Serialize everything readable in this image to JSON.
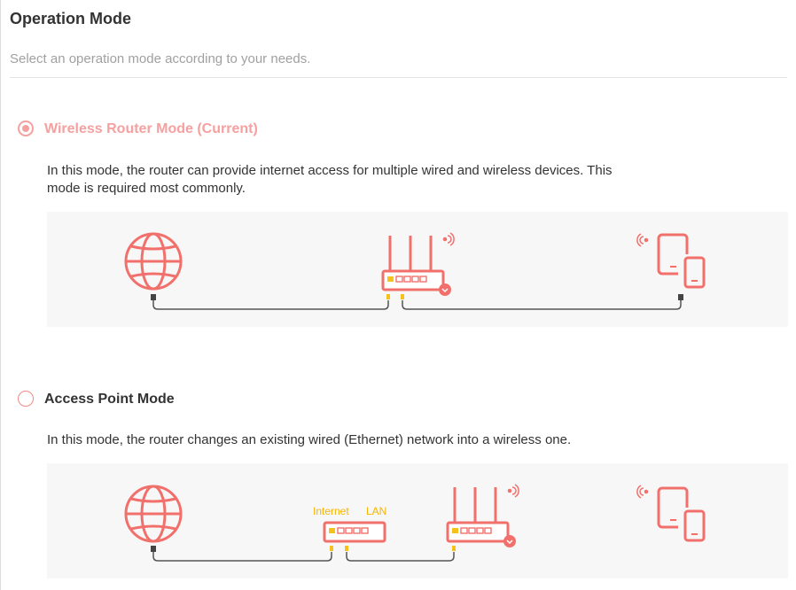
{
  "header": {
    "title": "Operation Mode",
    "subtitle": "Select an operation mode according to your needs."
  },
  "modes": [
    {
      "label": "Wireless Router Mode (Current)",
      "selected": true,
      "description_line1": "In this mode, the router can provide internet access for multiple wired and wireless devices. This",
      "description_line2": "mode is required most commonly."
    },
    {
      "label": "Access Point Mode",
      "selected": false,
      "description_line1": "In this mode, the router changes an existing wired (Ethernet) network into a wireless one."
    }
  ],
  "diagram2": {
    "internet_port_label": "Internet",
    "lan_port_label": "LAN"
  },
  "colors": {
    "accent": "#f2706c",
    "accent_light": "#f6a0a0",
    "port_yellow": "#f5c21b",
    "cable": "#555555",
    "diagram_bg": "#f7f7f7"
  },
  "icons": [
    "globe-icon",
    "router-icon",
    "wifi-signal-icon",
    "tablet-phone-icon",
    "switch-icon"
  ]
}
